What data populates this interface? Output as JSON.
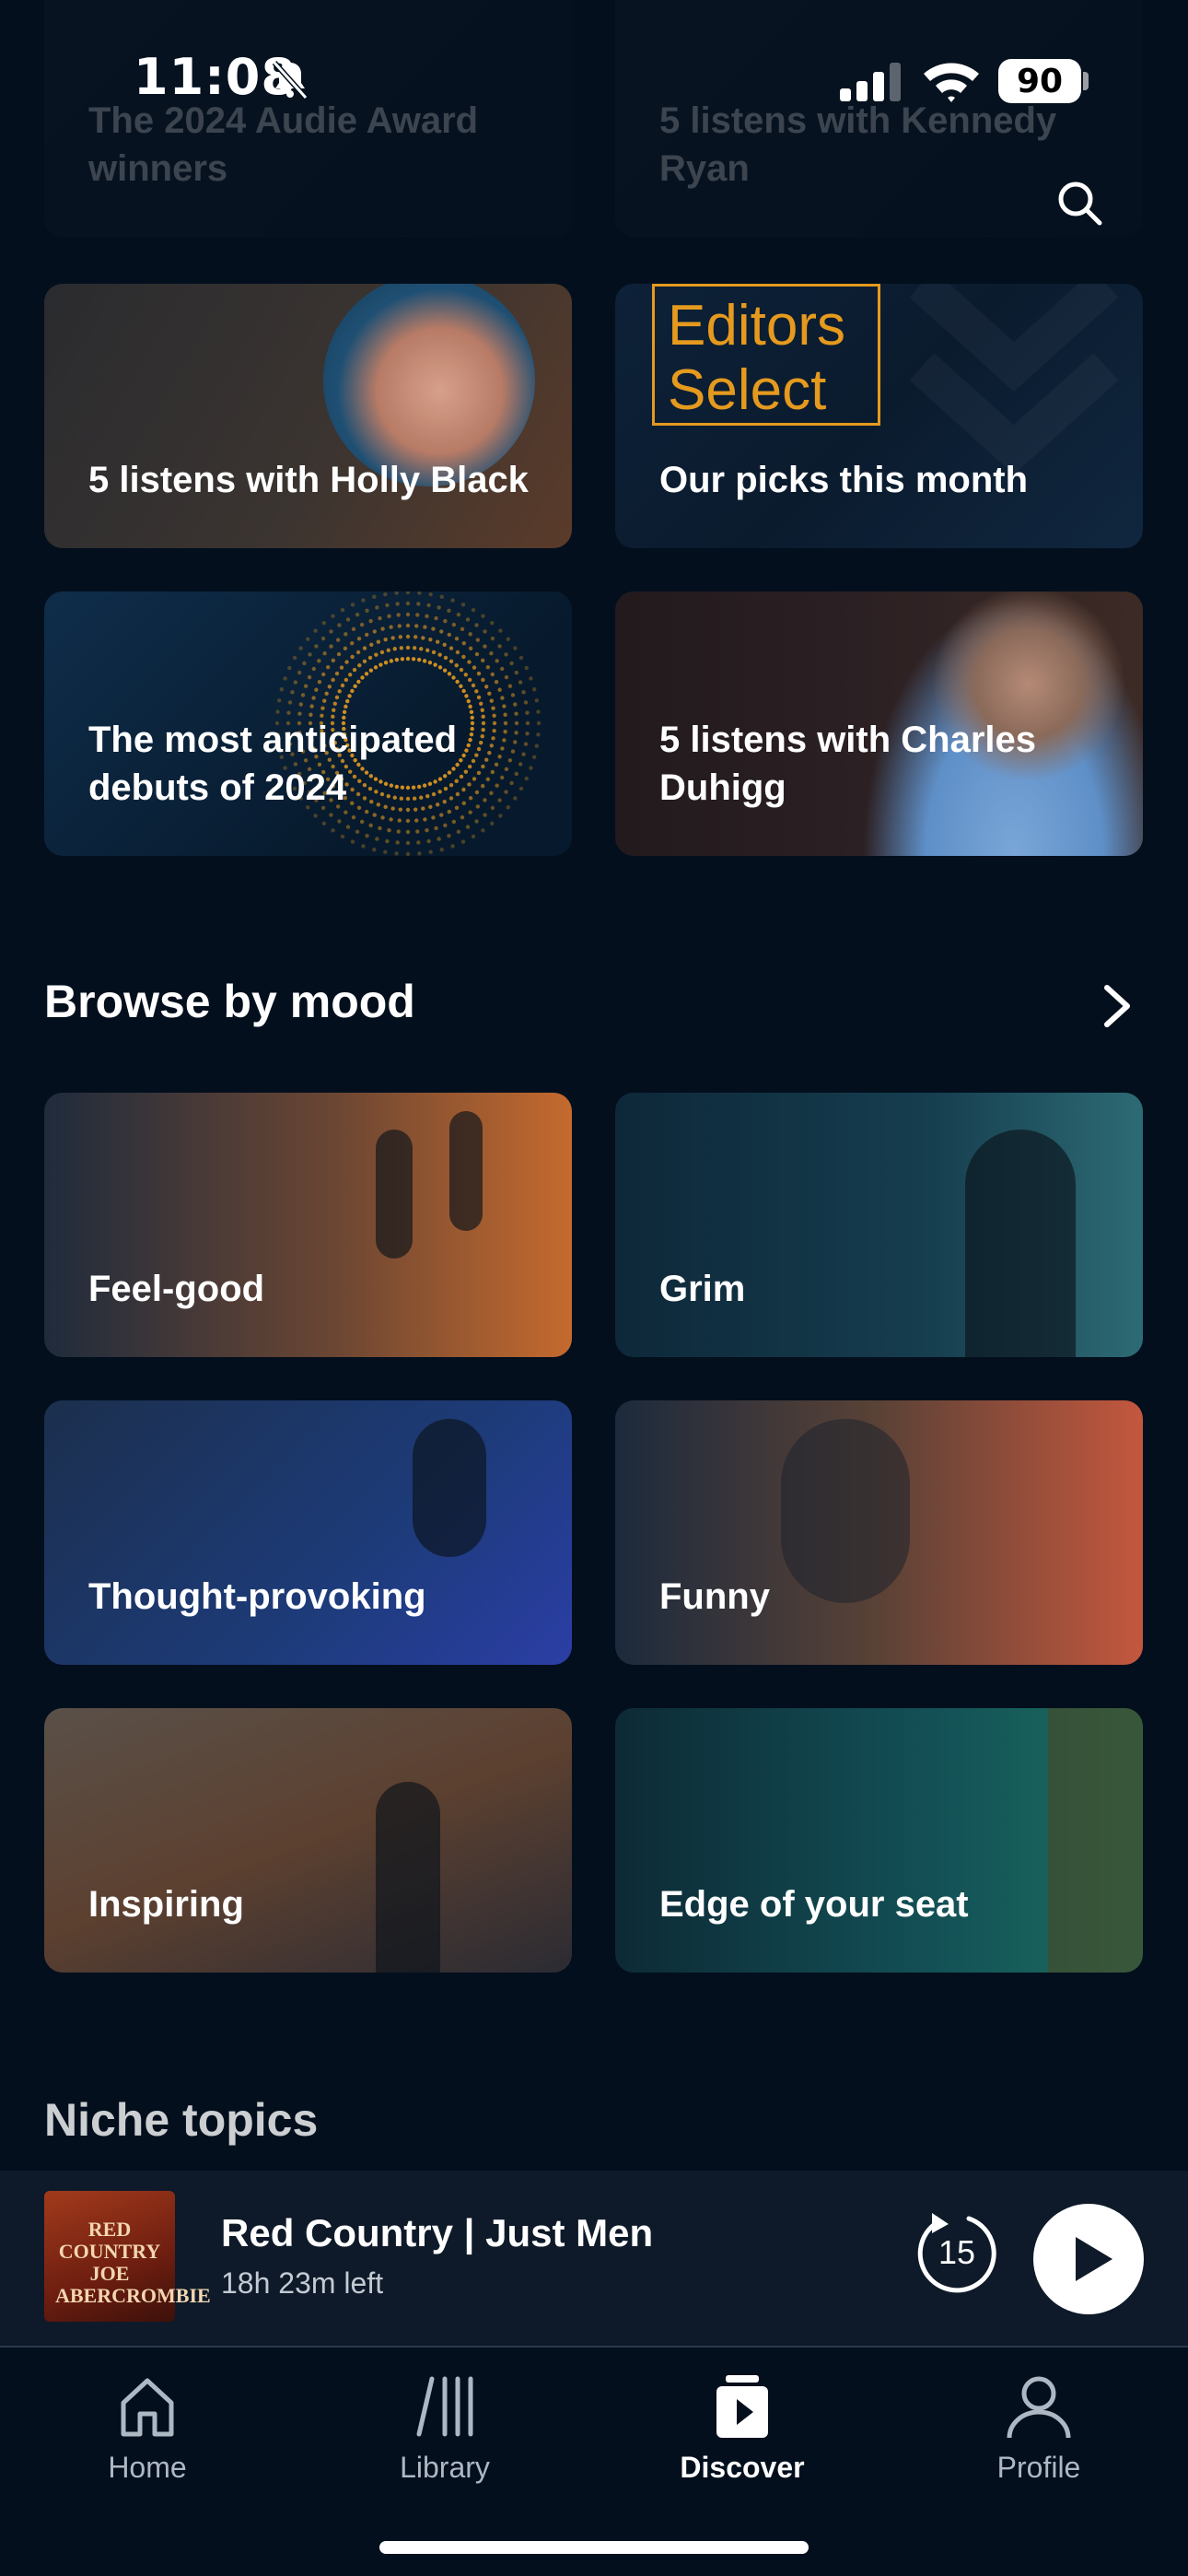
{
  "status_bar": {
    "time": "11:08",
    "battery": "90"
  },
  "featured_cards": [
    {
      "label": "The 2024 Audie Award winners"
    },
    {
      "label": "5 listens with Kennedy Ryan"
    },
    {
      "label": "5 listens with Holly Black"
    },
    {
      "label": "Our picks this month"
    },
    {
      "label": "The most anticipated debuts of 2024"
    },
    {
      "label": "5 listens with Charles Duhigg"
    }
  ],
  "editors_select": {
    "line1": "Editors",
    "line2": "Select"
  },
  "mood_section": {
    "title": "Browse by mood",
    "moods": [
      {
        "label": "Feel-good"
      },
      {
        "label": "Grim"
      },
      {
        "label": "Thought-provoking"
      },
      {
        "label": "Funny"
      },
      {
        "label": "Inspiring"
      },
      {
        "label": "Edge of your seat"
      }
    ]
  },
  "niche_section": {
    "title": "Niche topics"
  },
  "mini_player": {
    "title": "Red Country | Just Men",
    "time_left": "18h 23m left",
    "rewind_seconds": "15",
    "cover_text": "RED COUNTRY JOE ABERCROMBIE"
  },
  "tab_bar": {
    "tabs": [
      {
        "label": "Home",
        "icon": "home-icon"
      },
      {
        "label": "Library",
        "icon": "library-icon"
      },
      {
        "label": "Discover",
        "icon": "discover-icon",
        "active": true
      },
      {
        "label": "Profile",
        "icon": "profile-icon"
      }
    ]
  },
  "colors": {
    "background": "#030f1d",
    "accent_gold": "#e59a1e",
    "player_bg": "#0e1a29"
  }
}
